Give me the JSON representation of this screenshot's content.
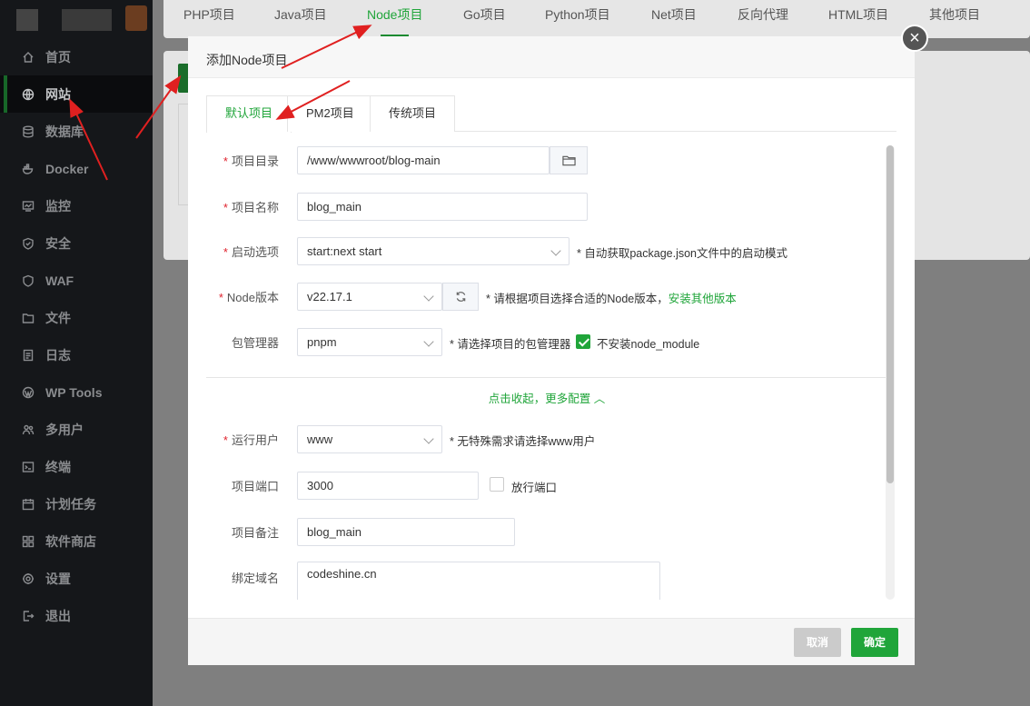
{
  "sidebar": {
    "items": [
      {
        "label": "首页",
        "icon": "home-icon",
        "active": false
      },
      {
        "label": "网站",
        "icon": "globe-icon",
        "active": true
      },
      {
        "label": "数据库",
        "icon": "database-icon",
        "active": false
      },
      {
        "label": "Docker",
        "icon": "docker-icon",
        "active": false
      },
      {
        "label": "监控",
        "icon": "monitor-icon",
        "active": false
      },
      {
        "label": "安全",
        "icon": "shield-icon",
        "active": false
      },
      {
        "label": "WAF",
        "icon": "waf-shield-icon",
        "active": false
      },
      {
        "label": "文件",
        "icon": "folder-icon",
        "active": false
      },
      {
        "label": "日志",
        "icon": "log-icon",
        "active": false
      },
      {
        "label": "WP Tools",
        "icon": "wordpress-icon",
        "active": false
      },
      {
        "label": "多用户",
        "icon": "users-icon",
        "active": false
      },
      {
        "label": "终端",
        "icon": "terminal-icon",
        "active": false
      },
      {
        "label": "计划任务",
        "icon": "calendar-icon",
        "active": false
      },
      {
        "label": "软件商店",
        "icon": "apps-icon",
        "active": false
      },
      {
        "label": "设置",
        "icon": "gear-icon",
        "active": false
      },
      {
        "label": "退出",
        "icon": "logout-icon",
        "active": false
      }
    ]
  },
  "top_tabs": [
    "PHP项目",
    "Java项目",
    "Node项目",
    "Go项目",
    "Python项目",
    "Net项目",
    "反向代理",
    "HTML项目",
    "其他项目"
  ],
  "top_tab_active": "Node项目",
  "modal": {
    "title": "添加Node项目",
    "close": "×",
    "tabs": [
      "默认项目",
      "PM2项目",
      "传统项目"
    ],
    "form": {
      "project_dir": {
        "label": "项目目录",
        "value": "/www/wwwroot/blog-main"
      },
      "project_name": {
        "label": "项目名称",
        "value": "blog_main"
      },
      "start_option": {
        "label": "启动选项",
        "value": "start:next start",
        "hint": "* 自动获取package.json文件中的启动模式"
      },
      "node_version": {
        "label": "Node版本",
        "value": "v22.17.1",
        "hint": "* 请根据项目选择合适的Node版本，",
        "hint_link": "安装其他版本"
      },
      "package_manager": {
        "label": "包管理器",
        "value": "pnpm",
        "hint": "* 请选择项目的包管理器",
        "checkbox_label": "不安装node_module",
        "checkbox_checked": true
      },
      "more_toggle": "点击收起，更多配置 ︿",
      "run_user": {
        "label": "运行用户",
        "value": "www",
        "hint": "* 无特殊需求请选择www用户"
      },
      "port": {
        "label": "项目端口",
        "value": "3000",
        "checkbox_label": "放行端口",
        "checkbox_checked": false
      },
      "remark": {
        "label": "项目备注",
        "value": "blog_main"
      },
      "domain": {
        "label": "绑定域名",
        "value": "codeshine.cn"
      }
    },
    "footer": {
      "cancel": "取消",
      "ok": "确定"
    }
  },
  "colors": {
    "accent": "#20a53a",
    "required": "#e0232e",
    "sidebar_bg": "#15171a",
    "annotation": "#e02020"
  }
}
